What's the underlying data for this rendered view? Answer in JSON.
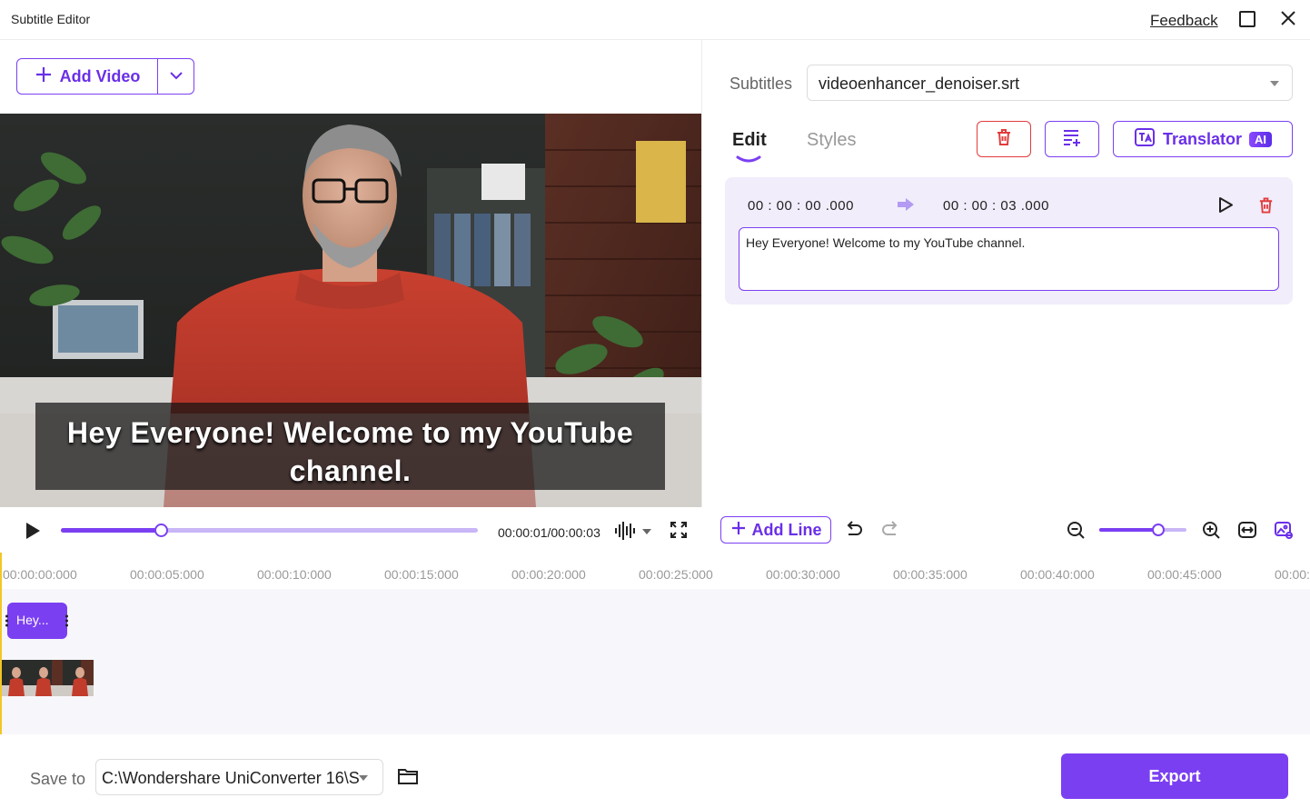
{
  "window": {
    "title": "Subtitle Editor",
    "feedback_label": "Feedback"
  },
  "left": {
    "add_video_label": "Add Video",
    "subtitle_overlay_line1": "Hey Everyone! Welcome to my YouTube",
    "subtitle_overlay_line2": "channel.",
    "time_readout": "00:00:01/00:00:03",
    "progress_fraction": 0.24
  },
  "right": {
    "subtitles_label": "Subtitles",
    "subtitle_file": "videoenhancer_denoiser.srt",
    "tabs": [
      {
        "label": "Edit",
        "active": true
      },
      {
        "label": "Styles",
        "active": false
      }
    ],
    "translator_label": "Translator",
    "ai_badge": "AI",
    "line": {
      "start": "00 : 00 : 00 .000",
      "end": "00 : 00 : 03 .000",
      "text": "Hey Everyone! Welcome to my YouTube channel."
    },
    "add_line_label": "Add Line",
    "zoom_fraction": 0.68
  },
  "timeline": {
    "ticks": [
      "00:00:00:000",
      "00:00:05:000",
      "00:00:10:000",
      "00:00:15:000",
      "00:00:20:000",
      "00:00:25:000",
      "00:00:30:000",
      "00:00:35:000",
      "00:00:40:000",
      "00:00:45:000",
      "00:00:"
    ],
    "subtitle_clip_label": "Hey..."
  },
  "bottom": {
    "save_to_label": "Save to",
    "save_path": "C:\\Wondershare UniConverter 16\\S",
    "export_label": "Export"
  },
  "colors": {
    "accent": "#7b3ff2",
    "danger": "#e23c3c",
    "playhead": "#f3c623"
  },
  "icons": [
    "plus-icon",
    "chevron-down-icon",
    "play-icon",
    "waveform-icon",
    "fullscreen-icon",
    "trash-icon",
    "merge-lines-icon",
    "translate-icon",
    "arrow-right-icon",
    "undo-icon",
    "redo-icon",
    "zoom-out-icon",
    "zoom-in-icon",
    "fit-width-icon",
    "thumbnail-icon",
    "folder-icon",
    "close-icon",
    "maximize-icon"
  ]
}
